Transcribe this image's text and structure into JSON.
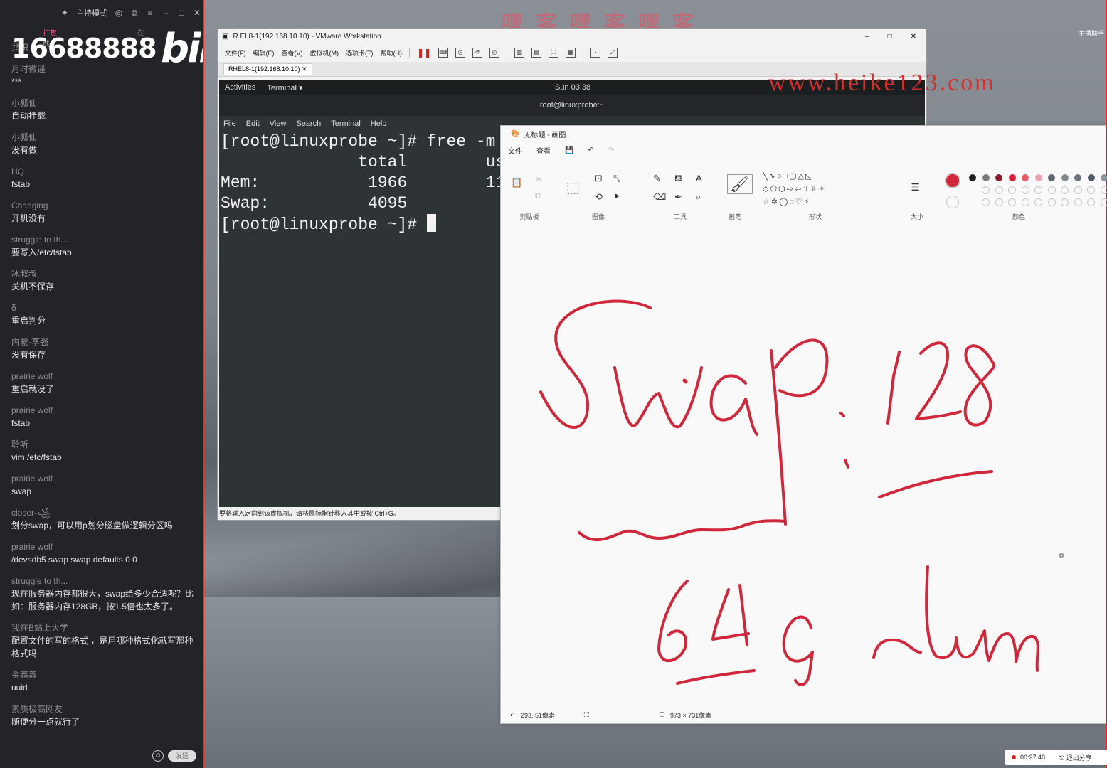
{
  "chat": {
    "mode_label": "主持模式",
    "tabs": [
      "打赏",
      "在线"
    ],
    "big_number": "16688888",
    "logo_text": "bili",
    "messages": [
      {
        "user": "共识",
        "text": ""
      },
      {
        "user": "月时微遥",
        "text": "***"
      },
      {
        "user": "小狐仙",
        "text": "自动挂载"
      },
      {
        "user": "小狐仙",
        "text": "没有做"
      },
      {
        "user": "HQ",
        "text": "fstab"
      },
      {
        "user": "Changing",
        "text": "开机没有"
      },
      {
        "user": "struggle to th...",
        "text": "要写入/etc/fstab"
      },
      {
        "user": "冰叔叔",
        "text": "关机不保存"
      },
      {
        "user": "δ",
        "text": "重启判分"
      },
      {
        "user": "内蒙-李强",
        "text": "没有保存"
      },
      {
        "user": "prairie wolf",
        "text": "重启就没了"
      },
      {
        "user": "prairie wolf",
        "text": "fstab"
      },
      {
        "user": "聆听",
        "text": "vim /etc/fstab"
      },
      {
        "user": "prairie wolf",
        "text": "swap"
      },
      {
        "user": "closer-꧁",
        "text": "划分swap，可以用p划分磁盘做逻辑分区吗"
      },
      {
        "user": "prairie wolf",
        "text": "/devsdb5 swap swap defaults 0 0"
      },
      {
        "user": "struggle to th...",
        "text": "现在服务器内存都很大，swap给多少合适呢？比如：服务器内存128GB，按1.5倍也太多了。"
      },
      {
        "user": "我在B站上大学",
        "text": "配置文件的写的格式 ，是用哪种格式化就写那种格式吗"
      },
      {
        "user": "金鑫鑫",
        "text": "uuid"
      },
      {
        "user": "素质极高网友",
        "text": "随便分一点就行了"
      }
    ],
    "send_label": "发送"
  },
  "watermark": {
    "top": "嘿客嘿客嘿客",
    "url": "www.heike123.com"
  },
  "vmware": {
    "title": "RHEL8-1(192.168.10.10) - VMware Workstation",
    "title_short": "R  EL8-1(192.168.10.10) - VMware Workstation",
    "menus": [
      "文件(F)",
      "编辑(E)",
      "查看(V)",
      "虚拟机(M)",
      "选项卡(T)",
      "帮助(H)"
    ],
    "tab_label": "RHEL8-1(192.168.10.10)",
    "status_hint": "要将输入定向到该虚拟机，请将鼠标指针移入其中或按 Ctrl+G。"
  },
  "gnome": {
    "activities": "Activities",
    "terminal_menu": "Terminal ▾",
    "clock": "Sun 03:38",
    "window_title": "root@linuxprobe:~",
    "term_menus": [
      "File",
      "Edit",
      "View",
      "Search",
      "Terminal",
      "Help"
    ],
    "lines": [
      "[root@linuxprobe ~]# free -m",
      "              total        us",
      "Mem:           1966        11",
      "Swap:          4095",
      "[root@linuxprobe ~]# "
    ]
  },
  "paint": {
    "title": "无标题 - 画图",
    "menus": [
      "文件",
      "查看"
    ],
    "groups": [
      "剪贴板",
      "图像",
      "工具",
      "画笔",
      "形状",
      "大小",
      "颜色"
    ],
    "cursor_pos": "293, 51像素",
    "canvas_size": "973 × 731像素",
    "handwriting": [
      "Swap: 128",
      "64G ~lum"
    ],
    "palette": [
      "#1e1e1e",
      "#7a7a7a",
      "#8b1a2b",
      "#d8213b",
      "#e85c6c",
      "#f0a0ae",
      "#606a74",
      "#7e8994",
      "#6c7480",
      "#505a66",
      "#8c96a0",
      "#a0a8b0"
    ],
    "ink_color": "#d0283a"
  },
  "share": {
    "timer": "00:27:48",
    "exit_label": "退出分享"
  },
  "side_user": "主播助手"
}
